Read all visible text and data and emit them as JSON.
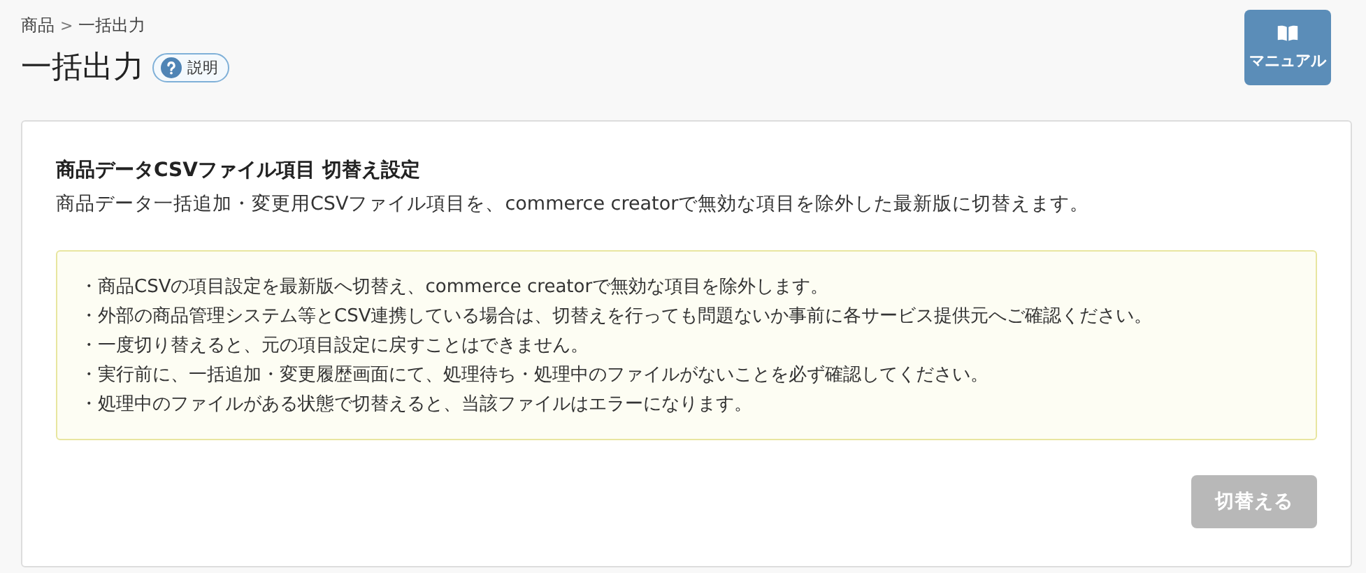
{
  "breadcrumb": [
    {
      "label": "商品"
    },
    {
      "label": "一括出力"
    }
  ],
  "breadcrumb_separator": ">",
  "title": "一括出力",
  "help_button": {
    "label": "説明"
  },
  "manual_button": {
    "label": "マニュアル"
  },
  "card": {
    "title": "商品データCSVファイル項目 切替え設定",
    "description": "商品データ一括追加・変更用CSVファイル項目を、commerce creatorで無効な項目を除外した最新版に切替えます。",
    "notices": [
      "・商品CSVの項目設定を最新版へ切替え、commerce creatorで無効な項目を除外します。",
      "・外部の商品管理システム等とCSV連携している場合は、切替えを行っても問題ないか事前に各サービス提供元へご確認ください。",
      "・一度切り替えると、元の項目設定に戻すことはできません。",
      "・実行前に、一括追加・変更履歴画面にて、処理待ち・処理中のファイルがないことを必ず確認してください。",
      "・処理中のファイルがある状態で切替えると、当該ファイルはエラーになります。"
    ],
    "button": {
      "label": "切替える",
      "disabled": true
    }
  }
}
